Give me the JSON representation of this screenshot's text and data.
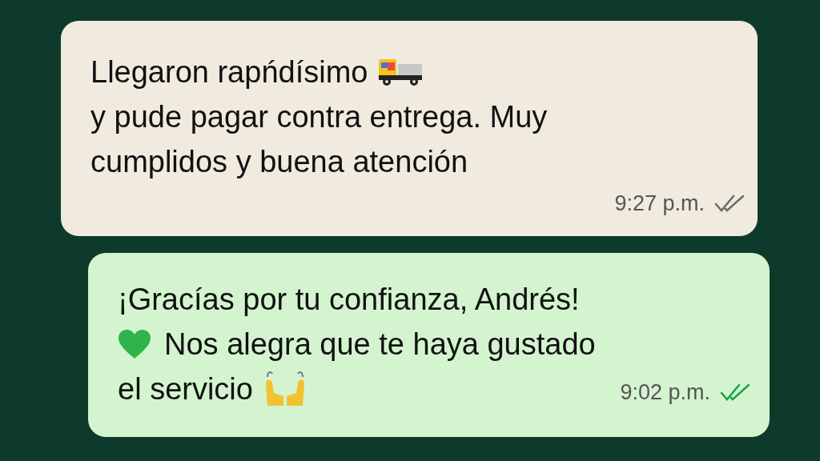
{
  "messages": [
    {
      "kind": "incoming",
      "lines": [
        "Llegaron rapńdísimo",
        "y pude pagar contra entrega. Muy",
        "cumplidos y buena atención"
      ],
      "time": "9:27 p.m.",
      "read": false
    },
    {
      "kind": "outgoing",
      "lines": [
        "¡Gracías por tu confianza, Andrés!",
        "Nos alegra que te haya gustado",
        "el servicio"
      ],
      "time": "9:02 p.m.",
      "read": true
    }
  ]
}
